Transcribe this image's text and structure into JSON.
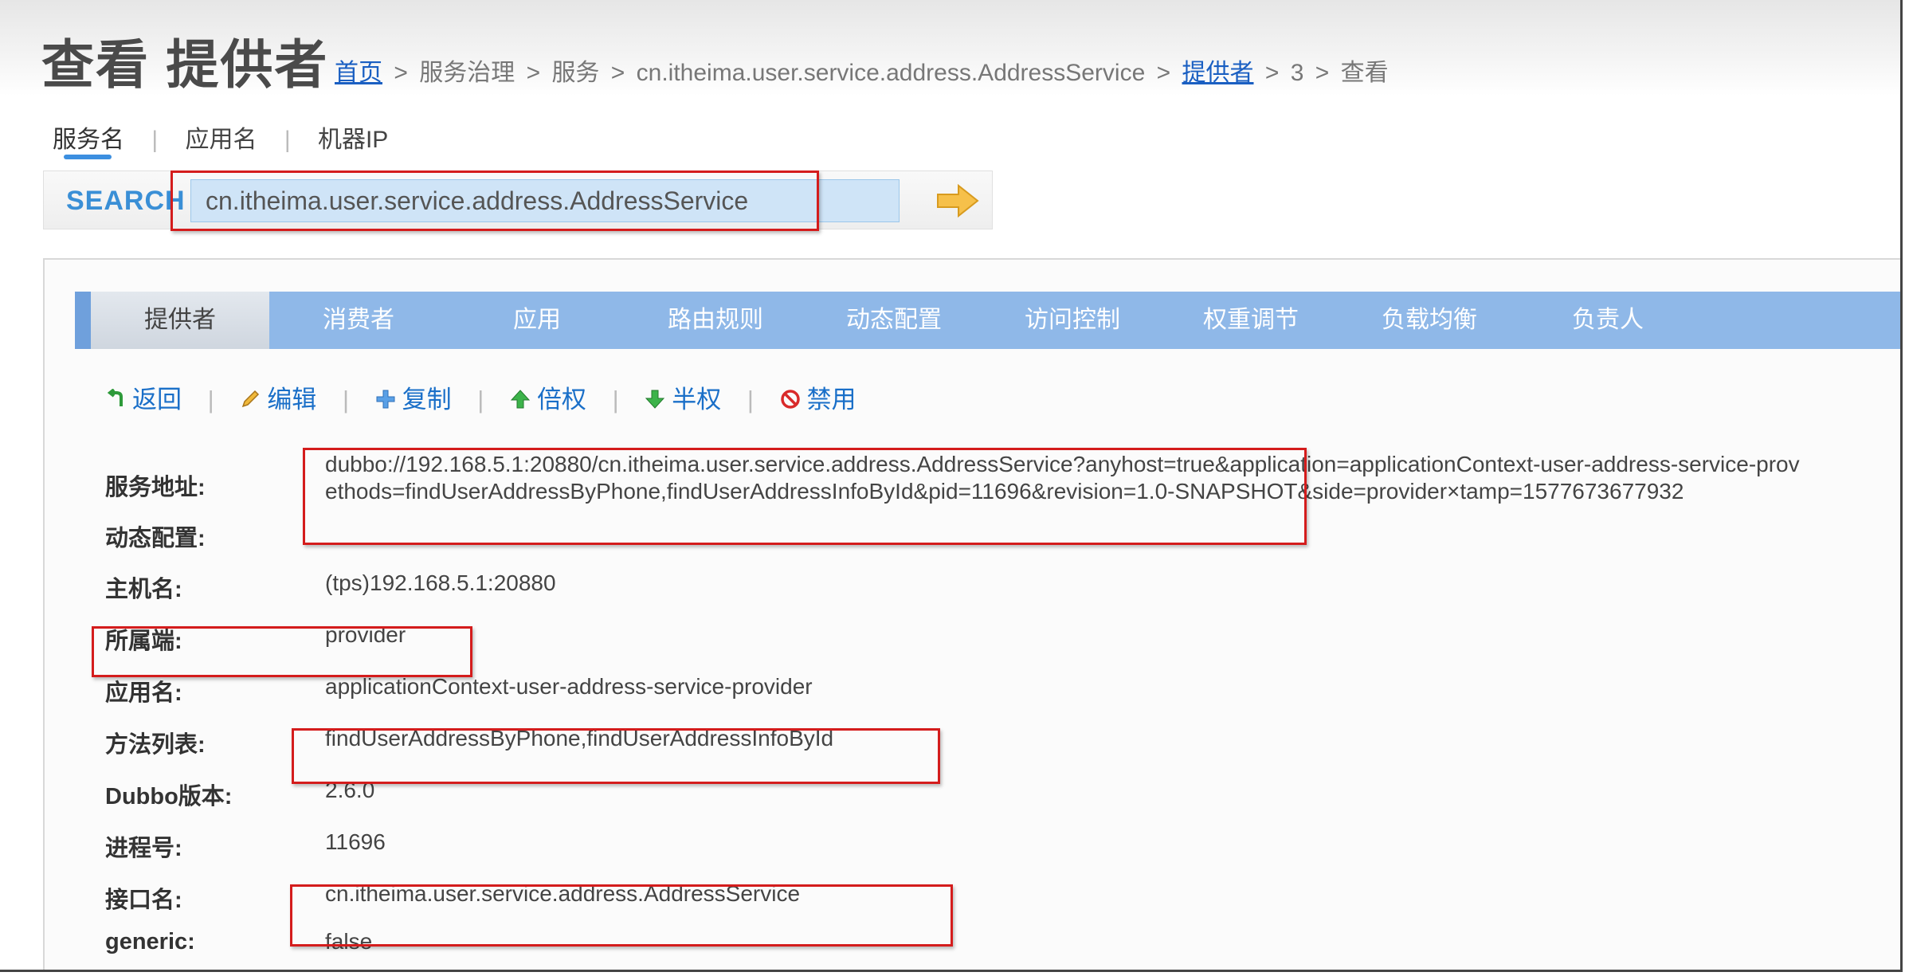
{
  "header": {
    "title": "查看 提供者",
    "breadcrumb": {
      "home": "首页",
      "sep": ">",
      "governance": "服务治理",
      "service": "服务",
      "service_name": "cn.itheima.user.service.address.AddressService",
      "providers": "提供者",
      "id": "3",
      "view": "查看"
    }
  },
  "search": {
    "type_tabs": [
      "服务名",
      "应用名",
      "机器IP"
    ],
    "divider": "|",
    "label": "SEARCH",
    "value": "cn.itheima.user.service.address.AddressService",
    "go_icon": "arrow-right-icon"
  },
  "tabs": [
    "提供者",
    "消费者",
    "应用",
    "路由规则",
    "动态配置",
    "访问控制",
    "权重调节",
    "负载均衡",
    "负责人"
  ],
  "actions": {
    "back": "返回",
    "edit": "编辑",
    "copy": "复制",
    "double": "倍权",
    "half": "半权",
    "disable": "禁用",
    "divider": "|"
  },
  "details": {
    "address_label": "服务地址:",
    "address_value": "dubbo://192.168.5.1:20880/cn.itheima.user.service.address.AddressService?anyhost=true&application=applicationContext-user-address-service-prov\nethods=findUserAddressByPhone,findUserAddressInfoById&pid=11696&revision=1.0-SNAPSHOT&side=provider×tamp=1577673677932",
    "dynamic_label": "动态配置:",
    "host_label": "主机名:",
    "host_value": "(tps)192.168.5.1:20880",
    "side_label": "所属端:",
    "side_value": "provider",
    "app_label": "应用名:",
    "app_value": "applicationContext-user-address-service-provider",
    "methods_label": "方法列表:",
    "methods_value": "findUserAddressByPhone,findUserAddressInfoById",
    "dubbo_label": "Dubbo版本:",
    "dubbo_value": "2.6.0",
    "pid_label": "进程号:",
    "pid_value": "11696",
    "interface_label": "接口名:",
    "interface_value": "cn.itheima.user.service.address.AddressService",
    "generic_label": "generic:",
    "generic_value": "false"
  },
  "colors": {
    "tab_bar": "#8fb8e8",
    "link": "#1a6fc8",
    "highlight": "#d41c1c",
    "search_label": "#3a8fd6"
  }
}
